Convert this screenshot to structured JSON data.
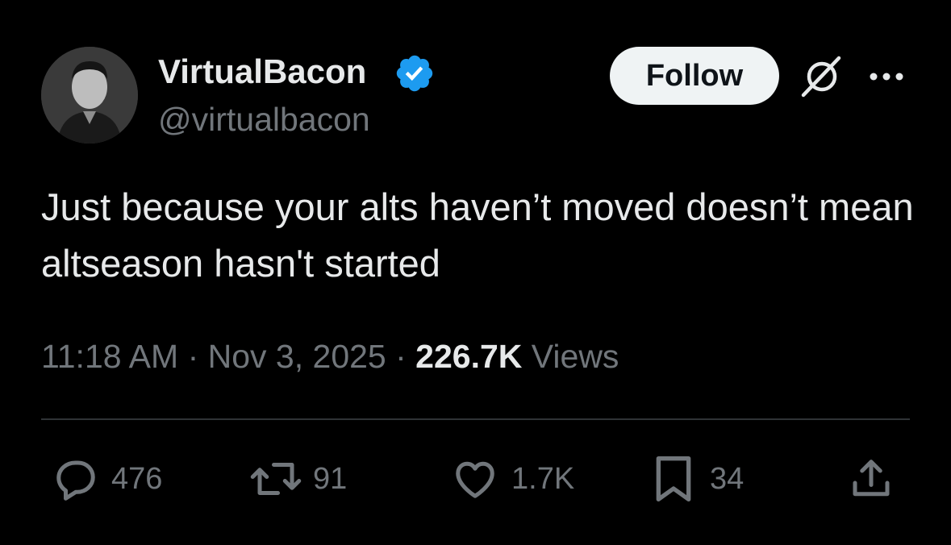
{
  "author": {
    "display_name": "VirtualBacon",
    "handle": "@virtualbacon",
    "verified": true,
    "verified_color": "#1d9bf0"
  },
  "header_actions": {
    "follow_label": "Follow",
    "grok_icon": "grok-icon",
    "more_icon": "more-horizontal-icon"
  },
  "tweet": {
    "text": "Just because your alts haven’t moved doesn’t mean altseason hasn't started",
    "time": "11:18 AM",
    "date": "Nov 3, 2025",
    "views_count": "226.7K",
    "views_label": "Views"
  },
  "actions": {
    "replies": "476",
    "reposts": "91",
    "likes": "1.7K",
    "bookmarks": "34"
  },
  "colors": {
    "background": "#000000",
    "text_primary": "#e7e9ea",
    "text_secondary": "#71767b",
    "divider": "#2f3336",
    "follow_bg": "#eff3f4"
  }
}
